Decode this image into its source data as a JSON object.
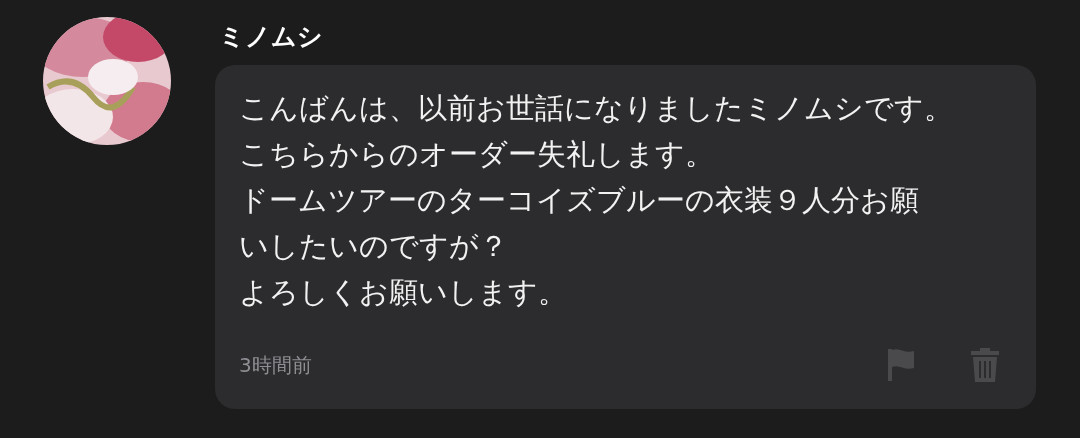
{
  "comment": {
    "author": "ミノムシ",
    "message_lines": [
      "こんばんは、以前お世話になりましたミノムシです。",
      "こちらからのオーダー失礼します。",
      "ドームツアーのターコイズブルーの衣装９人分お願",
      "いしたいのですが？",
      "よろしくお願いします。"
    ],
    "time": "3時間前"
  }
}
